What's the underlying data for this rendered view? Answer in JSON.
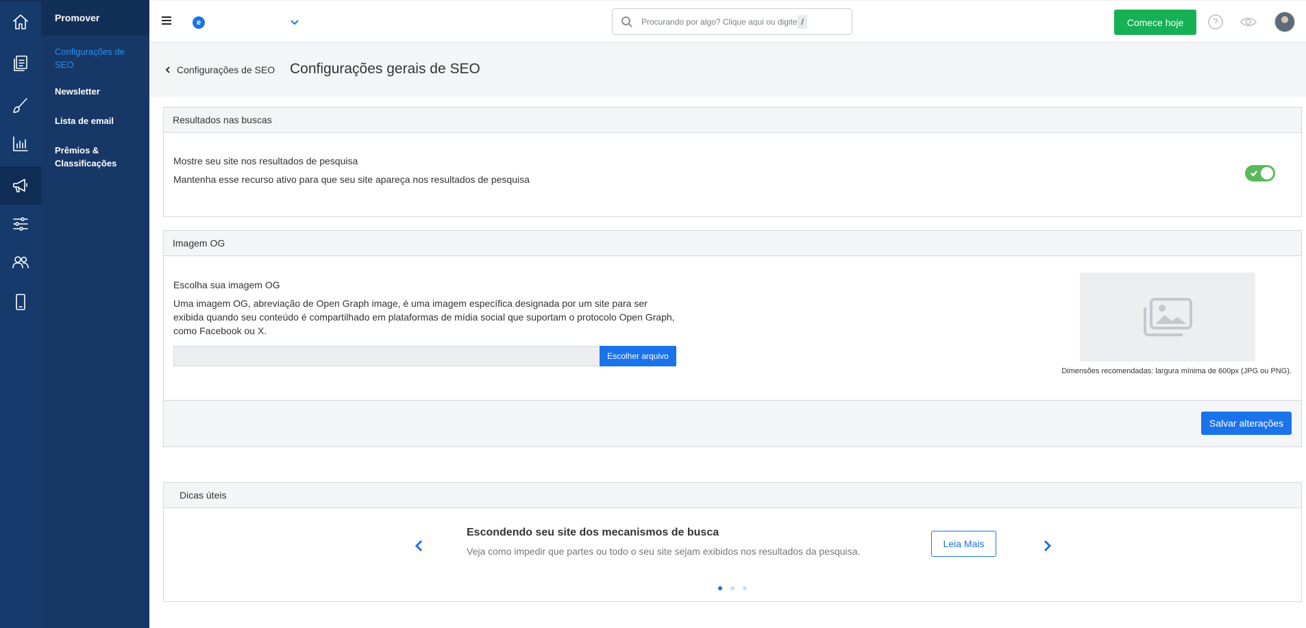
{
  "rail": {
    "items": [
      {
        "icon": "home-icon",
        "active": false
      },
      {
        "icon": "pages-icon",
        "active": false
      },
      {
        "icon": "brush-icon",
        "active": false
      },
      {
        "icon": "chart-icon",
        "active": false
      },
      {
        "icon": "megaphone-icon",
        "active": true
      },
      {
        "icon": "sliders-icon",
        "active": false
      },
      {
        "icon": "users-icon",
        "active": false
      },
      {
        "icon": "mobile-icon",
        "active": false
      }
    ]
  },
  "subnav": {
    "title": "Promover",
    "items": [
      {
        "label": "Configurações de SEO",
        "active": true
      },
      {
        "label": "Newsletter",
        "active": false
      },
      {
        "label": "Lista de email",
        "active": false
      },
      {
        "label": "Prêmios & Classificações",
        "active": false
      }
    ]
  },
  "topbar": {
    "site_logo_letter": "e",
    "search_placeholder": "Procurando por algo? Clique aqui ou digite",
    "search_shortcut": "/",
    "cta_label": "Comece hoje"
  },
  "page": {
    "back_label": "Configurações de SEO",
    "title": "Configurações gerais de SEO"
  },
  "search_results": {
    "header": "Resultados nas buscas",
    "title": "Mostre seu site nos resultados de pesquisa",
    "description": "Mantenha esse recurso ativo para que seu site apareça nos resultados de pesquisa",
    "toggle_on": true
  },
  "og_image": {
    "header": "Imagem OG",
    "title": "Escolha sua imagem OG",
    "description": "Uma imagem OG, abreviação de Open Graph image, é uma imagem específica designada por um site para ser exibida quando seu conteúdo é compartilhado em plataformas de mídia social que suportam o protocolo Open Graph, como Facebook ou X.",
    "file_value": "",
    "choose_label": "Escolher arquivo",
    "note": "Dimensões recomendadas: largura mínima de 600px (JPG ou PNG).",
    "save_label": "Salvar alterações"
  },
  "tips": {
    "header": "Dicas úteis",
    "title": "Escondendo seu site dos mecanismos de busca",
    "description": "Veja como impedir que partes ou todo o seu site sejam exibidos nos resultados da pesquisa.",
    "read_more": "Leia Mais",
    "slides": 3,
    "active_slide": 1
  },
  "colors": {
    "rail_bg": "#153a6b",
    "accent": "#1a73e8",
    "cta_green": "#17b055",
    "toggle_green": "#5cb85c"
  }
}
